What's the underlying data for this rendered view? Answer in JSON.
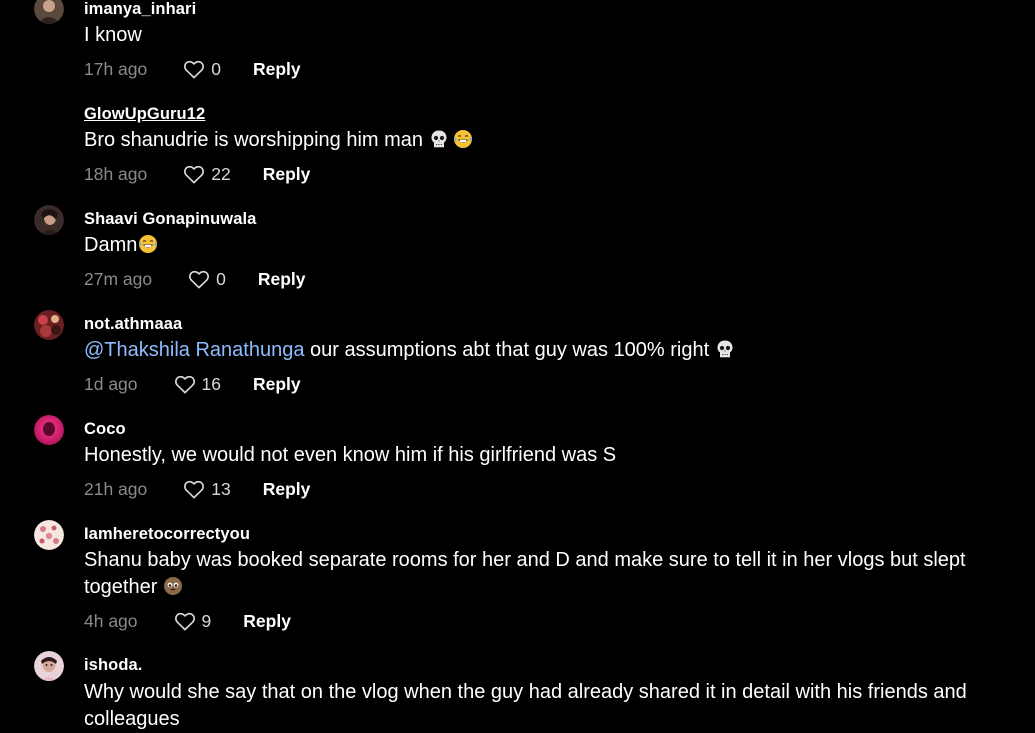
{
  "comments": [
    {
      "username": "imanya_inhari",
      "text": "I know",
      "time": "17h ago",
      "likes": "0",
      "reply_label": "Reply"
    },
    {
      "username": "GlowUpGuru12",
      "text": "Bro shanudrie is worshipping him man",
      "time": "18h ago",
      "likes": "22",
      "reply_label": "Reply"
    },
    {
      "username": "Shaavi Gonapinuwala",
      "text": "Damn",
      "time": "27m ago",
      "likes": "0",
      "reply_label": "Reply"
    },
    {
      "username": "not.athmaaa",
      "mention": "@Thakshila Ranathunga",
      "text": " our assumptions abt that guy was 100% right",
      "time": "1d ago",
      "likes": "16",
      "reply_label": "Reply"
    },
    {
      "username": "Coco",
      "text": "Honestly, we would not even know him if his girlfriend was S",
      "time": "21h ago",
      "likes": "13",
      "reply_label": "Reply"
    },
    {
      "username": "Iamheretocorrectyou",
      "text": "Shanu baby was booked separate rooms for her and D and make sure to tell it in her vlogs but slept together",
      "time": "4h ago",
      "likes": "9",
      "reply_label": "Reply"
    },
    {
      "username": "ishoda.",
      "text": "Why would she say that on the vlog when the guy had already shared it in detail with his friends and colleagues"
    }
  ],
  "icons": {
    "like": "heart-outline-icon",
    "skull": "skull-emoji",
    "laugh": "tears-of-joy-emoji",
    "shy": "shy-face-emoji"
  },
  "colors": {
    "background": "#000000",
    "text": "#ffffff",
    "meta": "#8a8a8a",
    "mention": "#8fbcff"
  }
}
